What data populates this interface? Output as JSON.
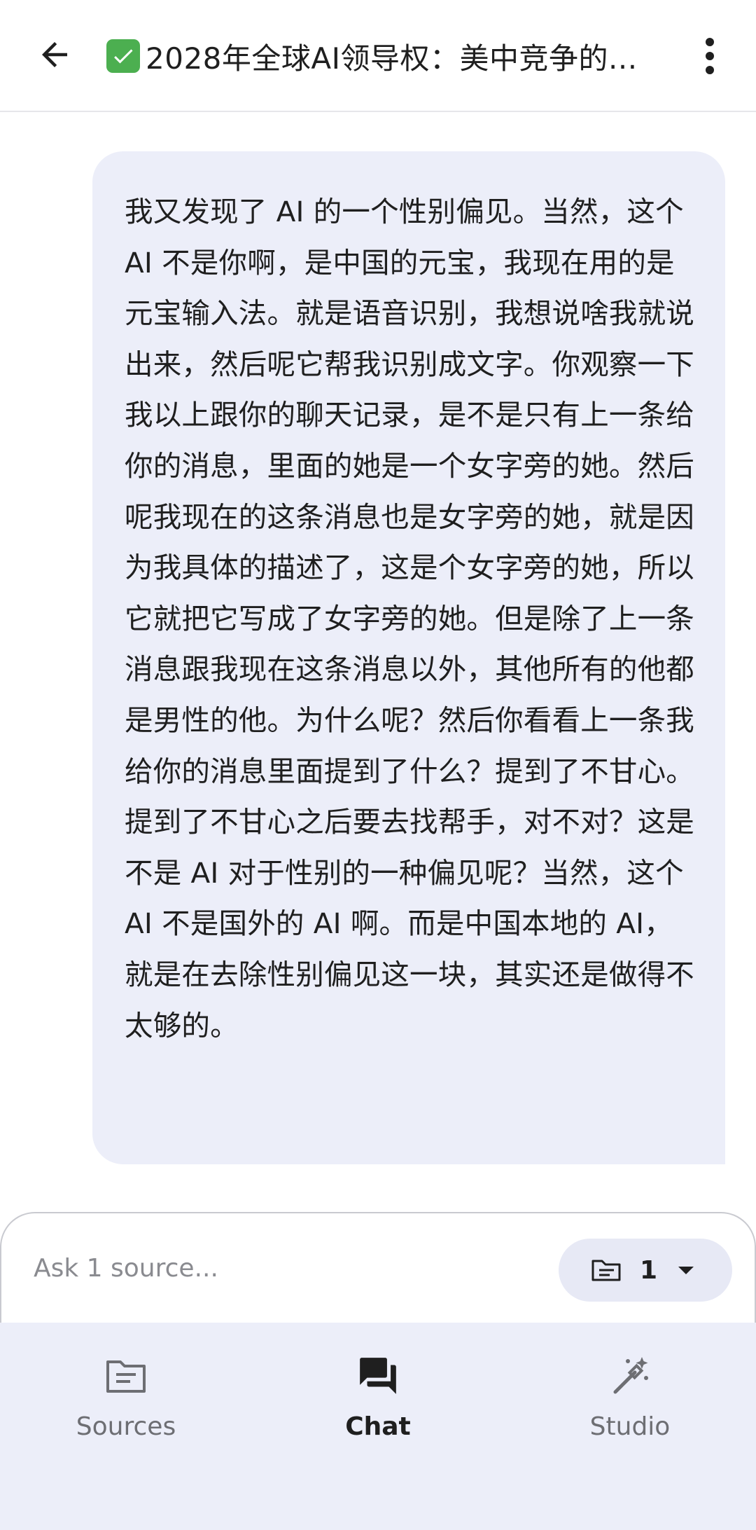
{
  "header": {
    "back_icon": "arrow-back-icon",
    "check_icon": "check-mark-button-icon",
    "title": "2028年全球AI领导权：美中竞争的...",
    "more_icon": "more-vert-icon"
  },
  "message": {
    "role": "user",
    "text": "我又发现了 AI 的一个性别偏见。当然，这个 AI 不是你啊，是中国的元宝，我现在用的是元宝输入法。就是语音识别，我想说啥我就说出来，然后呢它帮我识别成文字。你观察一下我以上跟你的聊天记录，是不是只有上一条给你的消息，里面的她是一个女字旁的她。然后呢我现在的这条消息也是女字旁的她，就是因为我具体的描述了，这是个女字旁的她，所以它就把它写成了女字旁的她。但是除了上一条消息跟我现在这条消息以外，其他所有的他都是男性的他。为什么呢？然后你看看上一条我给你的消息里面提到了什么？提到了不甘心。提到了不甘心之后要去找帮手，对不对？这是不是 AI 对于性别的一种偏见呢？当然，这个 AI 不是国外的 AI 啊。而是中国本地的 AI，就是在去除性别偏见这一块，其实还是做得不太够的。"
  },
  "composer": {
    "placeholder": "Ask 1 source...",
    "source_chip": {
      "icon": "folder-icon",
      "count": "1",
      "caret_icon": "dropdown-caret-icon"
    }
  },
  "bottom_nav": {
    "items": [
      {
        "label": "Sources",
        "icon": "sources-icon",
        "active": false
      },
      {
        "label": "Chat",
        "icon": "chat-icon",
        "active": true
      },
      {
        "label": "Studio",
        "icon": "magic-wand-icon",
        "active": false
      }
    ]
  },
  "colors": {
    "bubble_bg": "#eceef9",
    "nav_bg": "#eceef9",
    "chip_bg": "#e7e9f5",
    "check_green": "#4caf50",
    "text_primary": "#1f1f1f",
    "text_muted": "#6d6e73",
    "placeholder": "#8a8b90"
  }
}
